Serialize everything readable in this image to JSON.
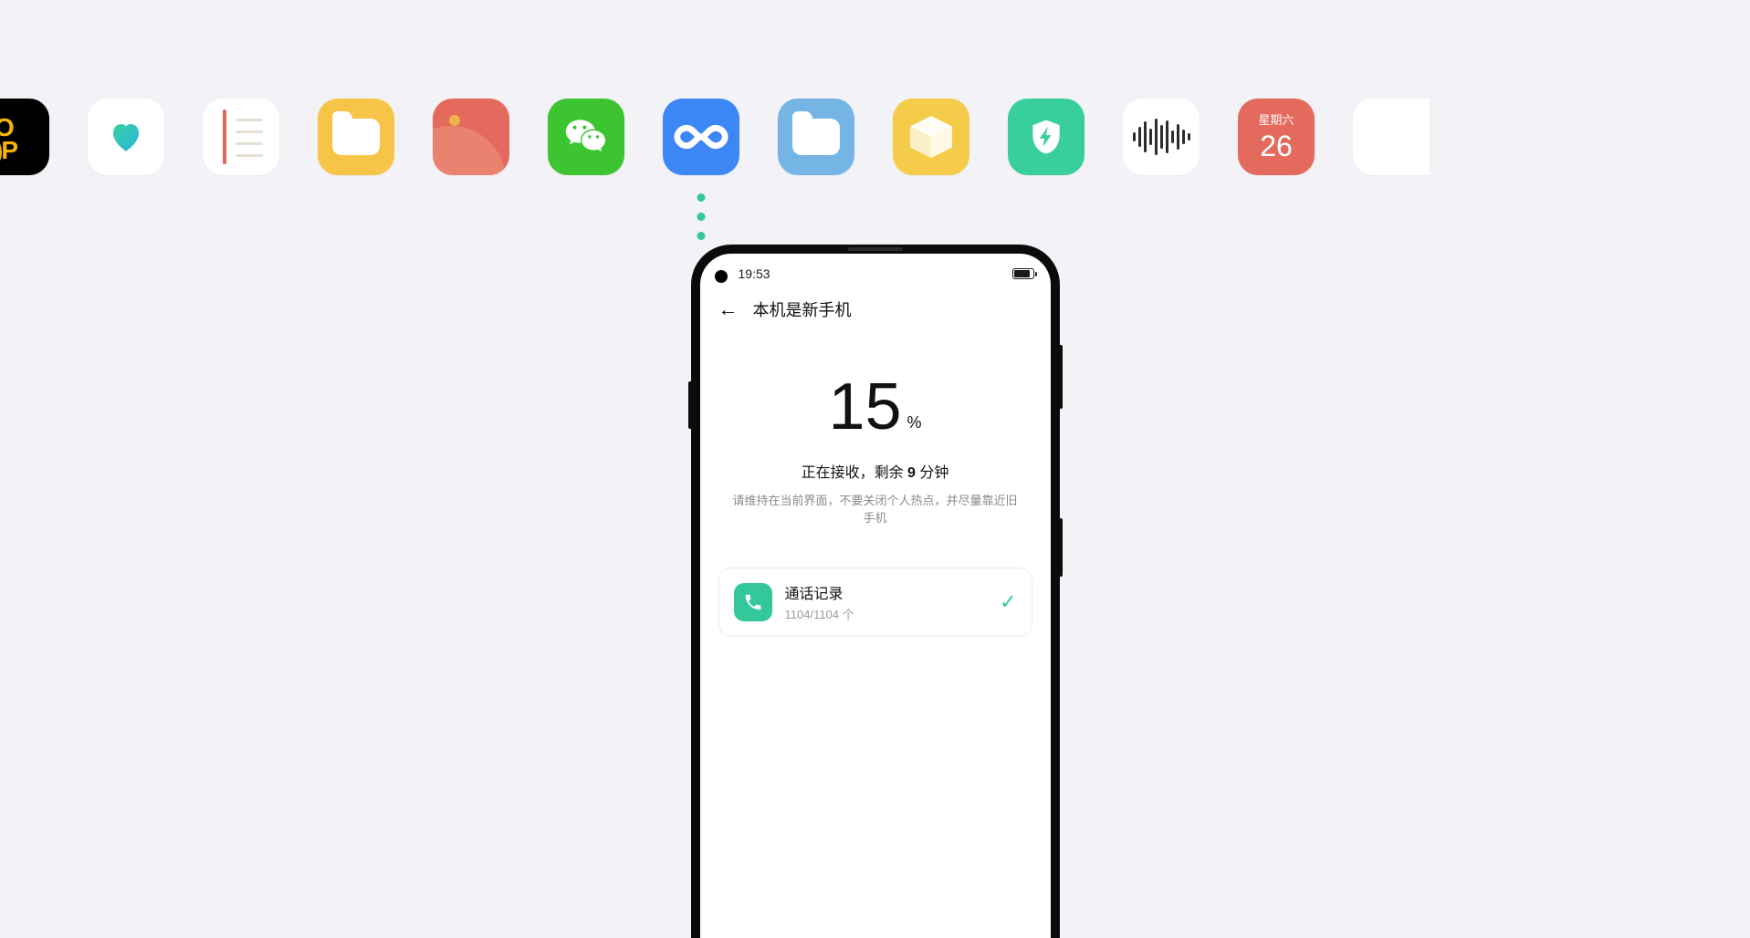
{
  "calendar": {
    "dow": "星期六",
    "day": "26"
  },
  "statusbar": {
    "time": "19:53"
  },
  "page": {
    "title": "本机是新手机",
    "percent": "15",
    "percent_unit": "%",
    "status_prefix": "正在接收，剩余 ",
    "status_bold": "9",
    "status_suffix": " 分钟",
    "hint": "请维持在当前界面，不要关闭个人热点，并尽量靠近旧手机"
  },
  "card": {
    "name": "通话记录",
    "sub": "1104/1104 个"
  }
}
